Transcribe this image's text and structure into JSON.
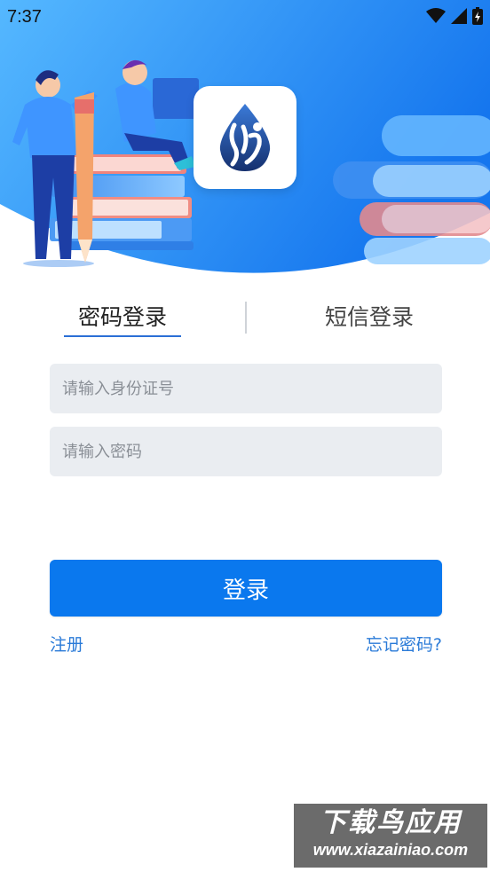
{
  "status_bar": {
    "time": "7:37"
  },
  "tabs": {
    "password_login": "密码登录",
    "sms_login": "短信登录",
    "active": "password_login"
  },
  "form": {
    "id_placeholder": "请输入身份证号",
    "id_value": "",
    "password_placeholder": "请输入密码",
    "password_value": ""
  },
  "actions": {
    "login": "登录",
    "register": "注册",
    "forgot_password": "忘记密码?"
  },
  "watermark": {
    "main": "下载鸟应用",
    "url": "www.xiazainiao.com"
  },
  "colors": {
    "primary": "#0a78ee",
    "link": "#2b7bd8",
    "hero_blue": "#1f8ff0",
    "input_bg": "#eaedf1"
  }
}
